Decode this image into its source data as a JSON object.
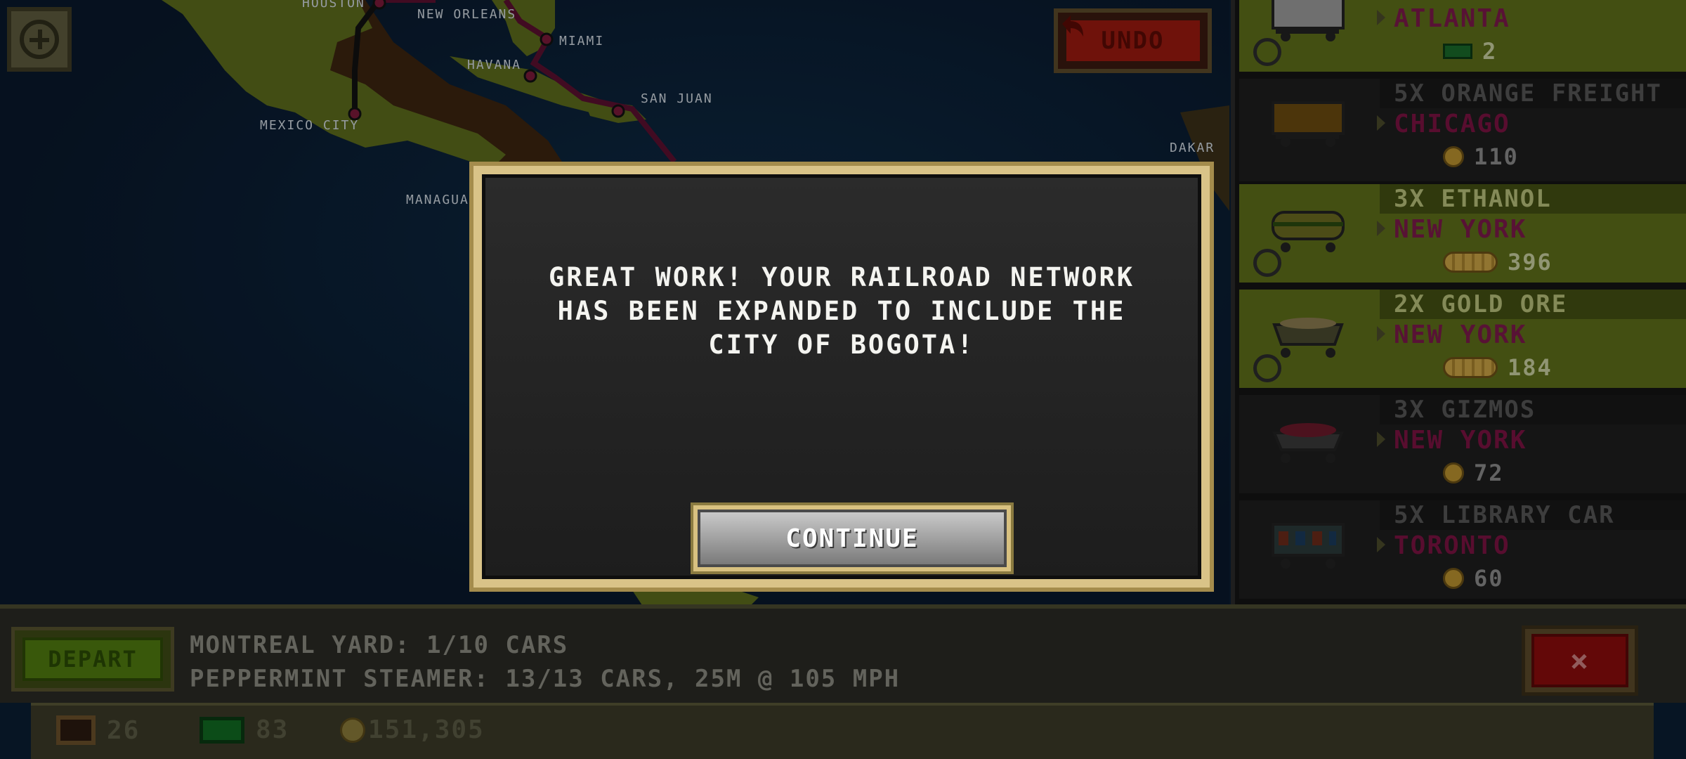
{
  "map": {
    "cities": [
      {
        "name": "HOUSTON"
      },
      {
        "name": "NEW ORLEANS"
      },
      {
        "name": "MIAMI"
      },
      {
        "name": "HAVANA"
      },
      {
        "name": "SAN JUAN"
      },
      {
        "name": "MEXICO CITY"
      },
      {
        "name": "DAKAR"
      },
      {
        "name": "MANAGUA"
      }
    ],
    "undo_label": "UNDO"
  },
  "orders": [
    {
      "quantity_label": "",
      "destination": "ATLANTA",
      "reward": "2",
      "reward_type": "cash",
      "style": "green"
    },
    {
      "quantity_label": "5X ORANGE FREIGHT",
      "destination": "CHICAGO",
      "reward": "110",
      "reward_type": "coin",
      "style": "dark"
    },
    {
      "quantity_label": "3X ETHANOL",
      "destination": "NEW YORK",
      "reward": "396",
      "reward_type": "coinstack",
      "style": "green"
    },
    {
      "quantity_label": "2X GOLD ORE",
      "destination": "NEW YORK",
      "reward": "184",
      "reward_type": "coinstack",
      "style": "green"
    },
    {
      "quantity_label": "3X GIZMOS",
      "destination": "NEW YORK",
      "reward": "72",
      "reward_type": "coin",
      "style": "dark"
    },
    {
      "quantity_label": "5X LIBRARY CAR",
      "destination": "TORONTO",
      "reward": "60",
      "reward_type": "coin",
      "style": "dark"
    }
  ],
  "bottom": {
    "depart_label": "DEPART",
    "yard_status": "MONTREAL YARD: 1/10 CARS",
    "train_status": "PEPPERMINT STEAMER: 13/13 CARS, 25M @ 105 MPH",
    "close_label": "×"
  },
  "resources": {
    "cars": "26",
    "cash": "83",
    "coins": "151,305"
  },
  "dialog": {
    "line1": "GREAT WORK! YOUR RAILROAD NETWORK",
    "line2": "HAS BEEN EXPANDED TO INCLUDE THE",
    "line3": "CITY OF BOGOTA!",
    "continue_label": "CONTINUE"
  },
  "colors": {
    "land": "#5c6b1c",
    "ocean": "#0b1e33",
    "rail": "#6a1a3a",
    "dialog_frame": "#d9c388"
  },
  "icons": [
    "plus-icon",
    "undo-arrow-icon",
    "clock-icon",
    "coin-icon",
    "cash-icon",
    "close-icon"
  ]
}
